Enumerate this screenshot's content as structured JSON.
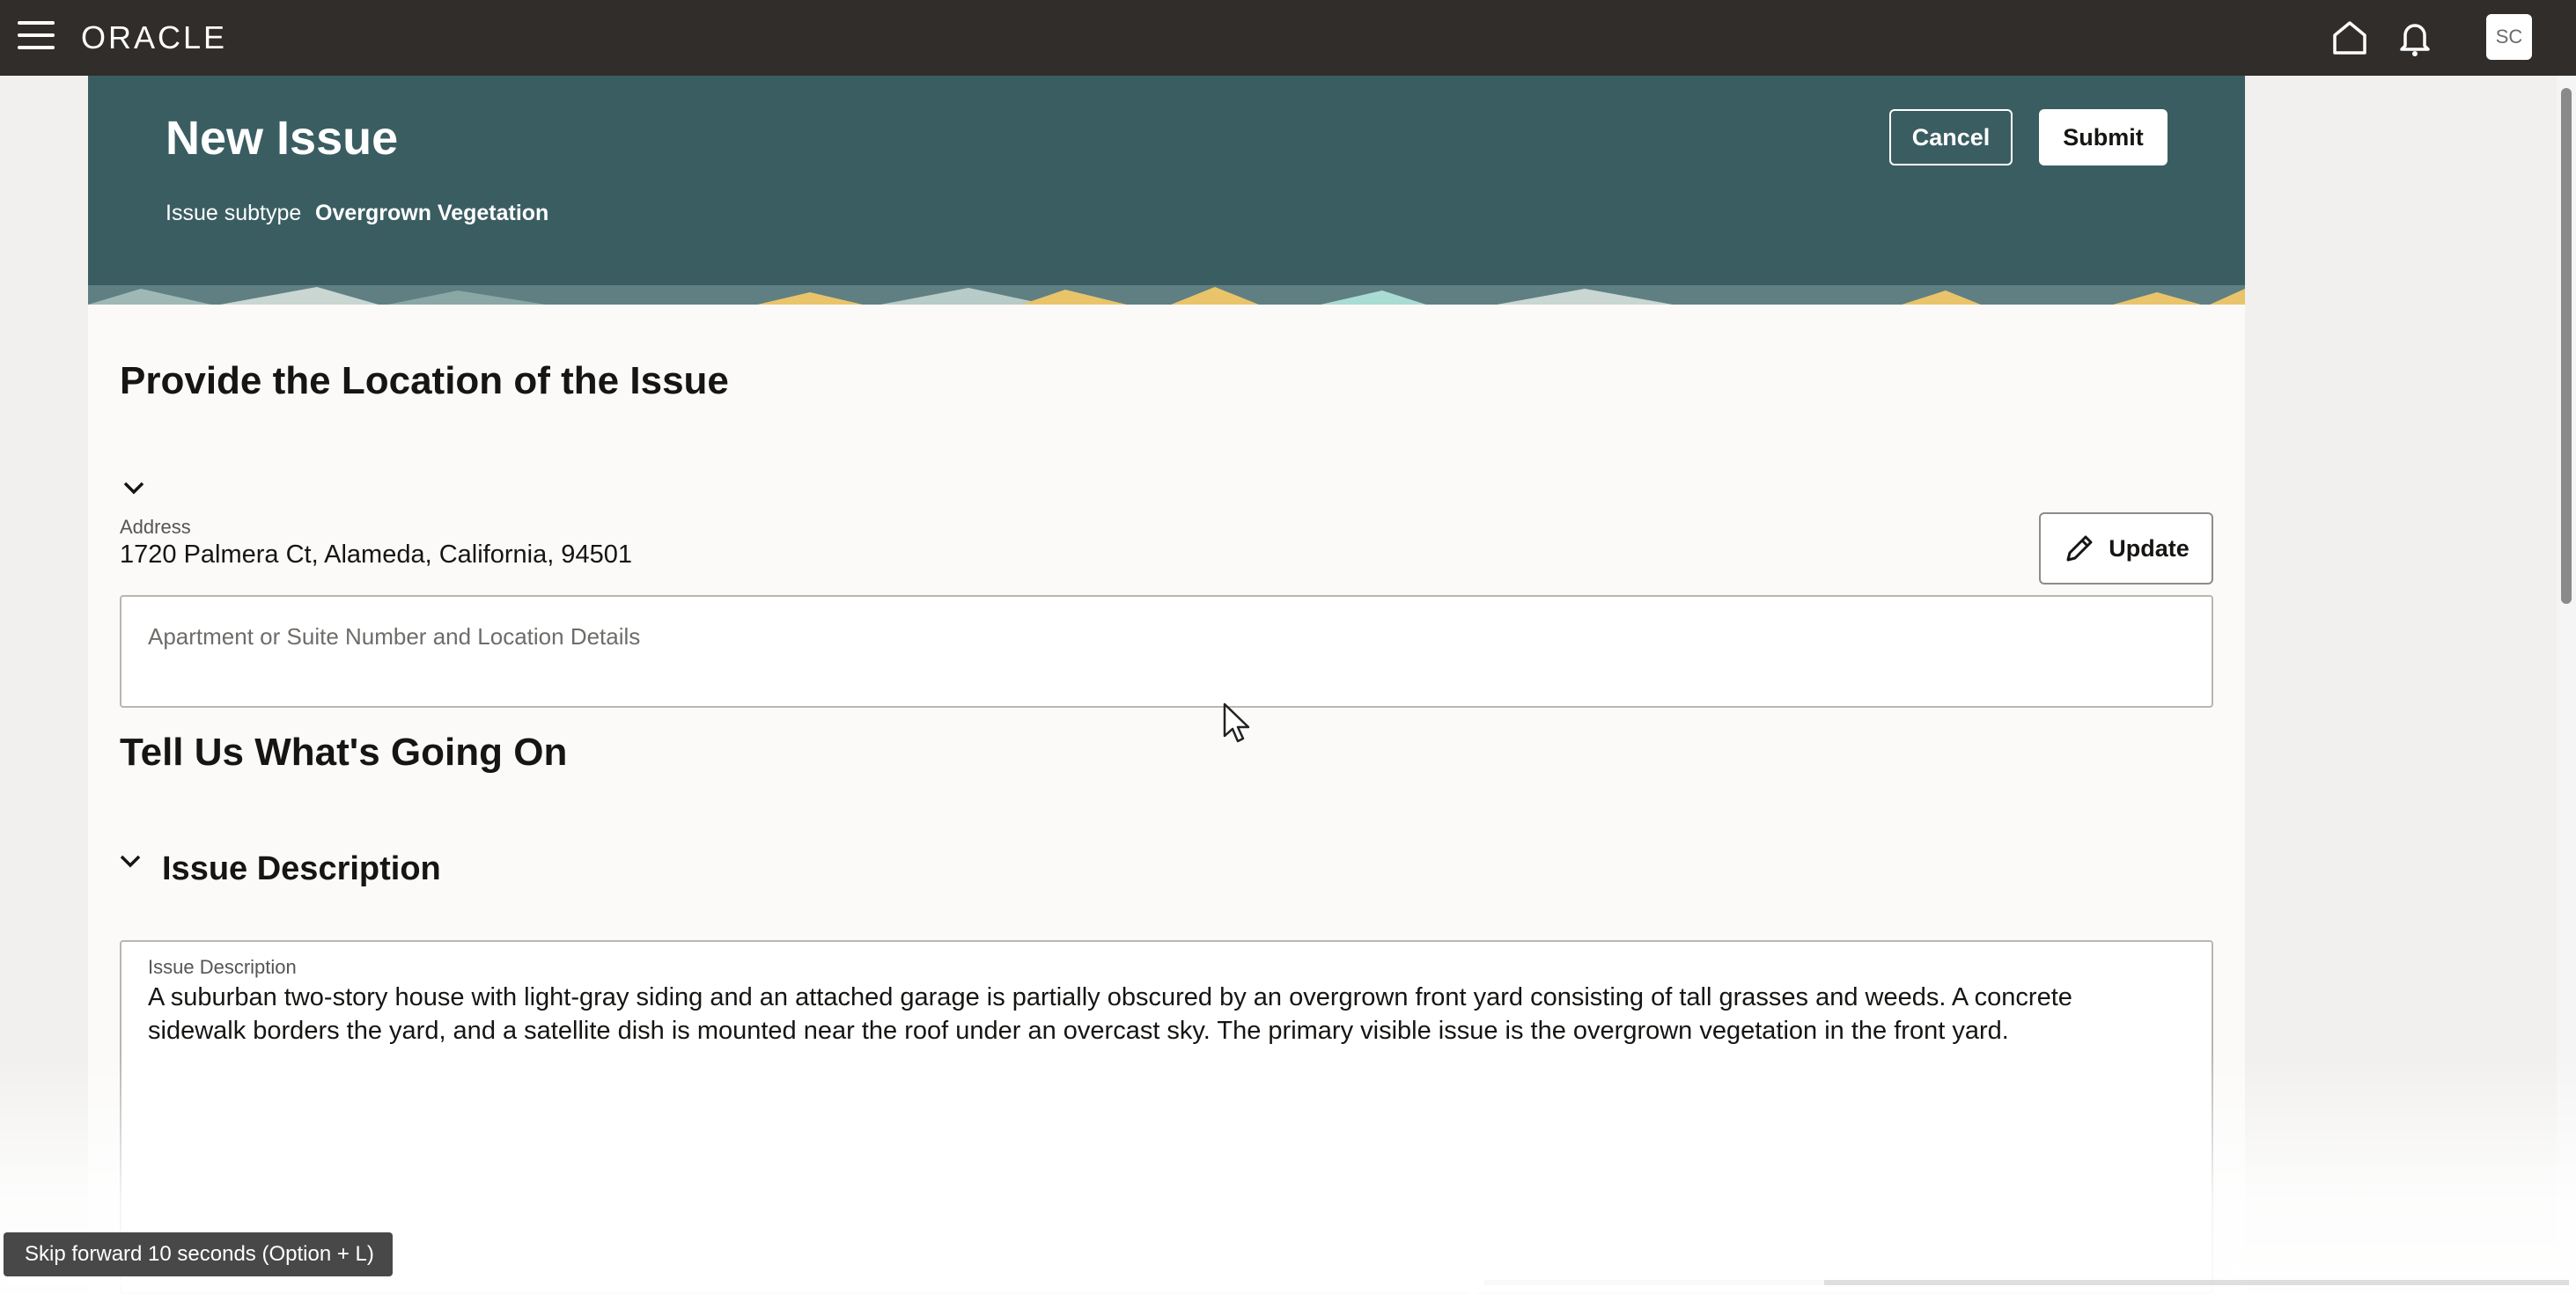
{
  "topbar": {
    "logo": "ORACLE",
    "avatar_initials": "SC"
  },
  "header": {
    "title": "New Issue",
    "subtype_label": "Issue subtype",
    "subtype_value": "Overgrown Vegetation",
    "cancel_label": "Cancel",
    "submit_label": "Submit"
  },
  "location": {
    "section_title": "Provide the Location of the Issue",
    "address_label": "Address",
    "address_value": "1720 Palmera Ct, Alameda, California, 94501",
    "update_label": "Update",
    "details_placeholder": "Apartment or Suite Number and Location Details"
  },
  "whats_going_on": {
    "section_title": "Tell Us What's Going On",
    "subsection_title": "Issue Description",
    "description_label": "Issue Description",
    "description_text": "A suburban two-story house with light-gray siding and an attached garage is partially obscured by an overgrown front yard consisting of tall grasses and weeds. A concrete sidewalk borders the yard, and a satellite dish is mounted near the roof under an overcast sky. The primary visible issue is the overgrown vegetation in the front yard."
  },
  "video_player": {
    "tooltip": "Skip forward 10 seconds (Option + L)",
    "progress_fraction": 0.57
  },
  "colors": {
    "topbar": "#312d2a",
    "banner": "#3a5d62",
    "accent_yellow": "#e9c46a"
  }
}
